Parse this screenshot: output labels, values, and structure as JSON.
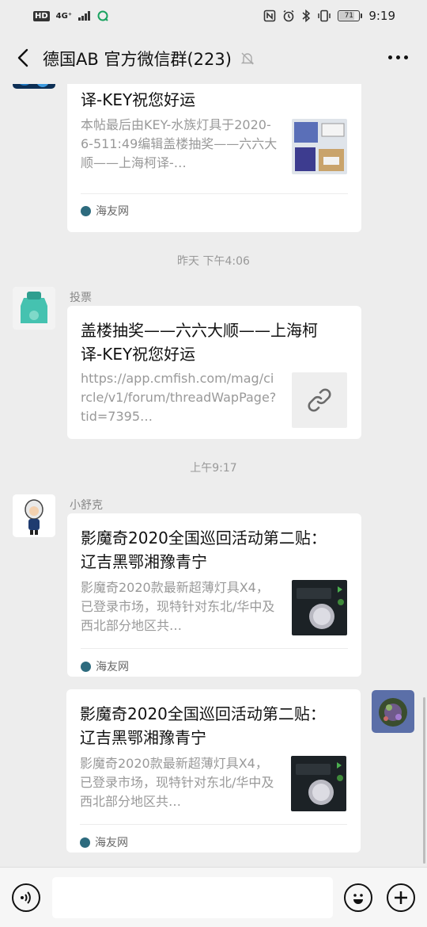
{
  "status_bar": {
    "hd_badge": "HD",
    "network": "4G⁺",
    "battery": "71",
    "time": "9:19"
  },
  "header": {
    "title": "德国AB  官方微信群(223)"
  },
  "messages": [
    {
      "type": "article",
      "title": "盖楼抽奖——六六大顺——上海柯译-KEY祝您好运",
      "desc": "本帖最后由KEY-水族灯具于2020-6-511:49编辑盖楼抽奖——六六大顺——上海柯译-…",
      "source": "海友网"
    },
    {
      "type": "timestamp",
      "text": "昨天 下午4:06"
    },
    {
      "type": "link",
      "sender": "投票",
      "title": "盖楼抽奖——六六大顺——上海柯译-KEY祝您好运",
      "desc": "https://app.cmfish.com/mag/circle/v1/forum/threadWapPage?tid=7395…"
    },
    {
      "type": "timestamp",
      "text": "上午9:17"
    },
    {
      "type": "article",
      "sender": "小舒克",
      "title": "影魔奇2020全国巡回活动第二贴： 辽吉黑鄂湘豫青宁",
      "desc": "影魔奇2020款最新超薄灯具X4，已登录市场，现特针对东北/华中及西北部分地区共…",
      "source": "海友网"
    },
    {
      "type": "article",
      "outgoing": true,
      "title": "影魔奇2020全国巡回活动第二贴： 辽吉黑鄂湘豫青宁",
      "desc": "影魔奇2020款最新超薄灯具X4，已登录市场，现特针对东北/华中及西北部分地区共…",
      "source": "海友网"
    }
  ],
  "input": {
    "placeholder": ""
  }
}
